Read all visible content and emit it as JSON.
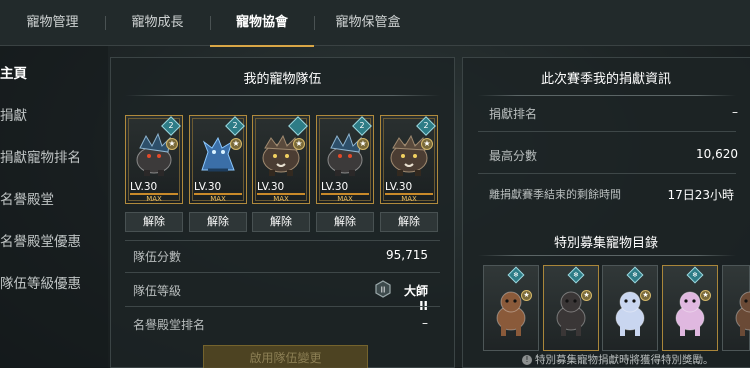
{
  "tabs": [
    {
      "label": "寵物管理"
    },
    {
      "label": "寵物成長"
    },
    {
      "label": "寵物協會"
    },
    {
      "label": "寵物保管盒"
    }
  ],
  "sidebar": {
    "items": [
      {
        "label": "主頁"
      },
      {
        "label": "捐獻"
      },
      {
        "label": "捐獻寵物排名"
      },
      {
        "label": "名譽殿堂"
      },
      {
        "label": "名譽殿堂優惠"
      },
      {
        "label": "隊伍等級優惠"
      }
    ]
  },
  "team": {
    "title": "我的寵物隊伍",
    "pets": [
      {
        "level": "LV.30",
        "max": "MAX",
        "elem_icon": "ice-element-icon",
        "elem_level": "2",
        "type": "armored-beast"
      },
      {
        "level": "LV.30",
        "max": "MAX",
        "elem_icon": "ice-element-icon",
        "elem_level": "2",
        "type": "blue-dragon"
      },
      {
        "level": "LV.30",
        "max": "MAX",
        "elem_icon": "ice-element-icon",
        "elem_level": "",
        "type": "wild-boar"
      },
      {
        "level": "LV.30",
        "max": "MAX",
        "elem_icon": "ice-element-icon",
        "elem_level": "2",
        "type": "armored-beast"
      },
      {
        "level": "LV.30",
        "max": "MAX",
        "elem_icon": "ice-element-icon",
        "elem_level": "2",
        "type": "wild-boar"
      }
    ],
    "release_label": "解除",
    "score_label": "隊伍分數",
    "score_value": "95,715",
    "level_label": "隊伍等級",
    "level_value": "大師II",
    "level_badge": "II",
    "hall_rank_label": "名譽殿堂排名",
    "hall_rank_value": "–",
    "apply_button": "啟用隊伍變更"
  },
  "season": {
    "title": "此次賽季我的捐獻資訊",
    "rank_label": "捐獻排名",
    "rank_value": "–",
    "best_label": "最高分數",
    "best_value": "10,620",
    "time_label": "離捐獻賽季結束的剩餘時間",
    "time_value": "17日23小時"
  },
  "special": {
    "title": "特別募集寵物目錄",
    "pets": [
      {
        "color": "#8a5a3a",
        "frame": "plain"
      },
      {
        "color": "#3a3636",
        "frame": "gold"
      },
      {
        "color": "#c9d6f0",
        "frame": "plain"
      },
      {
        "color": "#e0b8e0",
        "frame": "gold"
      },
      {
        "color": "#6a4a36",
        "frame": "plain"
      }
    ],
    "note": "特別募集寵物捐獻時將獲得特別獎勵。"
  },
  "colors": {
    "accent": "#d9a646",
    "element": "#2e7c86"
  }
}
